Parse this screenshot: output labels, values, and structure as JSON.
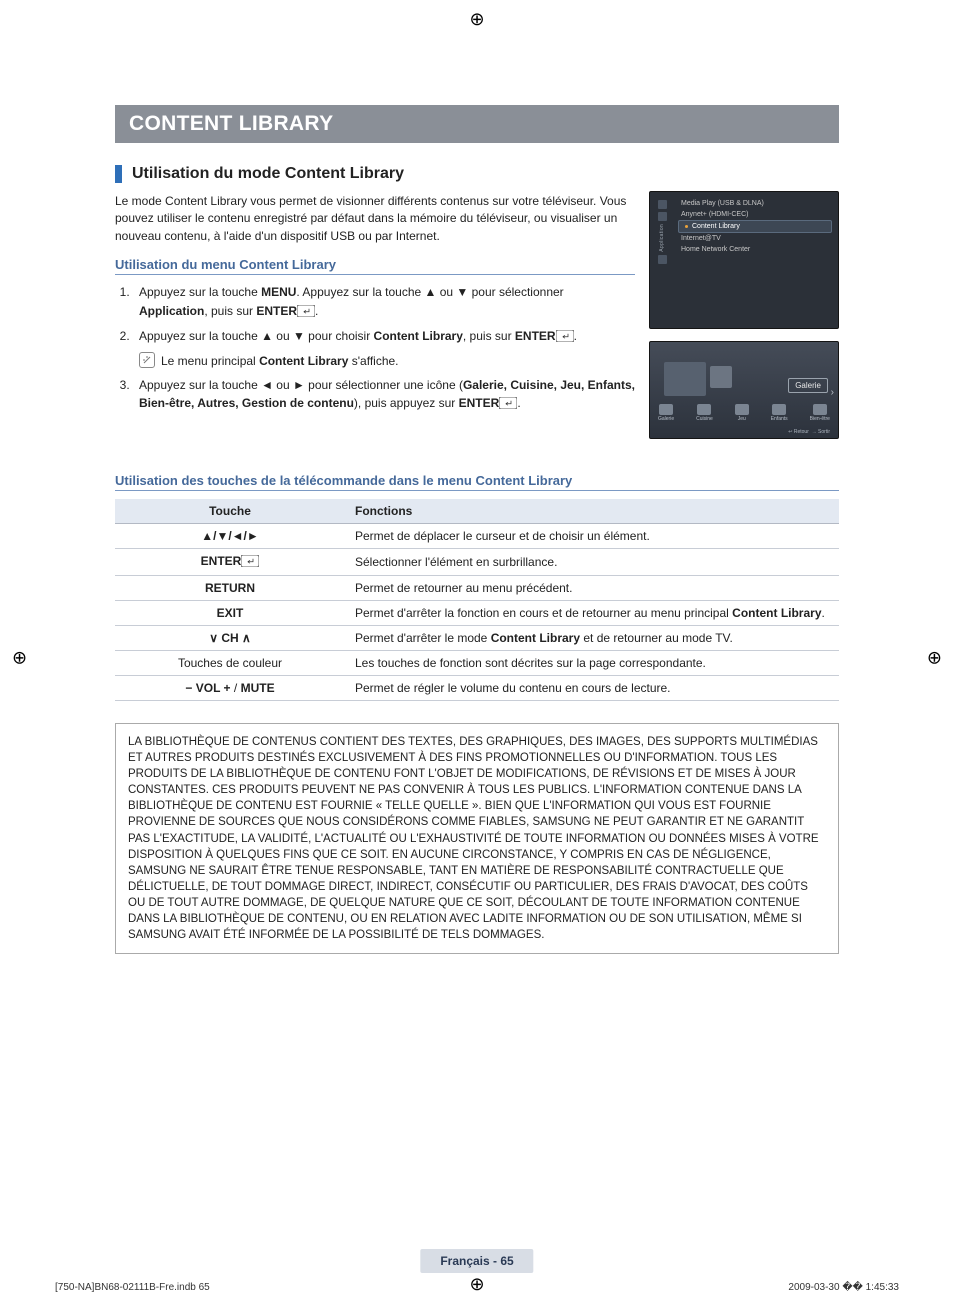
{
  "banner": "CONTENT LIBRARY",
  "h2": "Utilisation du mode Content Library",
  "intro": "Le mode Content Library vous permet de visionner différents contenus sur votre téléviseur. Vous pouvez utiliser le contenu enregistré par défaut dans la mémoire du téléviseur, ou visualiser un nouveau contenu, à l'aide d'un dispositif USB ou par Internet.",
  "sub1": "Utilisation du menu Content Library",
  "steps": {
    "s1a": "Appuyez sur la touche ",
    "s1b": "MENU",
    "s1c": ". Appuyez sur la touche ▲ ou ▼ pour sélectionner ",
    "s1d": "Application",
    "s1e": ", puis sur ",
    "s1f": "ENTER",
    "s1g": ".",
    "s2a": "Appuyez sur la touche ▲ ou ▼ pour choisir ",
    "s2b": "Content Library",
    "s2c": ", puis sur ",
    "s2d": "ENTER",
    "s2e": ".",
    "note_a": "Le menu principal ",
    "note_b": "Content Library",
    "note_c": " s'affiche.",
    "s3a": "Appuyez sur la touche ◄ ou ► pour sélectionner une icône (",
    "s3b": "Galerie, Cuisine, Jeu, Enfants, Bien-être, Autres, Gestion de contenu",
    "s3c": "), puis appuyez sur ",
    "s3d": "ENTER",
    "s3e": "."
  },
  "osd1": {
    "sideLabel": "Application",
    "i1": "Media Play (USB & DLNA)",
    "i2": "Anynet+ (HDMI-CEC)",
    "i3": "Content Library",
    "i4": "Internet@TV",
    "i5": "Home Network Center"
  },
  "osd2": {
    "btn": "Galerie",
    "ic1": "Galerie",
    "ic2": "Cuisine",
    "ic3": "Jeu",
    "ic4": "Enfants",
    "ic5": "Bien-être",
    "foot1": "↩ Retour",
    "foot2": "→ Sortir"
  },
  "sub2": "Utilisation des touches de la télécommande dans le menu Content Library",
  "table": {
    "h1": "Touche",
    "h2": "Fonctions",
    "r1k": "▲/▼/◄/►",
    "r1v": "Permet de déplacer le curseur et de choisir un élément.",
    "r2k": "ENTER",
    "r2v": "Sélectionner l'élément en surbrillance.",
    "r3k": "RETURN",
    "r3v": "Permet de retourner au menu précédent.",
    "r4k": "EXIT",
    "r4v_a": "Permet d'arrêter la fonction en cours et de retourner au menu principal ",
    "r4v_b": "Content Library",
    "r4v_c": ".",
    "r5k": "∨ CH ∧",
    "r5v_a": "Permet d'arrêter le mode ",
    "r5v_b": "Content Library",
    "r5v_c": " et de retourner au mode TV.",
    "r6k": "Touches de couleur",
    "r6v": "Les touches de fonction sont décrites sur la page correspondante.",
    "r7k_a": "− VOL +",
    "r7k_b": " / ",
    "r7k_c": "MUTE",
    "r7v": "Permet de régler le volume du contenu en cours de lecture."
  },
  "legal": "LA BIBLIOTHÈQUE DE CONTENUS CONTIENT DES TEXTES, DES GRAPHIQUES, DES IMAGES, DES SUPPORTS MULTIMÉDIAS ET AUTRES PRODUITS DESTINÉS EXCLUSIVEMENT À DES FINS PROMOTIONNELLES OU D'INFORMATION. TOUS LES PRODUITS DE LA BIBLIOTHÈQUE DE CONTENU FONT L'OBJET DE MODIFICATIONS, DE RÉVISIONS ET DE MISES À JOUR CONSTANTES. CES PRODUITS PEUVENT NE PAS CONVENIR À TOUS LES PUBLICS. L'INFORMATION CONTENUE DANS LA BIBLIOTHÈQUE DE CONTENU EST FOURNIE « TELLE QUELLE ». BIEN QUE L'INFORMATION QUI VOUS EST FOURNIE PROVIENNE DE SOURCES QUE NOUS CONSIDÉRONS COMME FIABLES, SAMSUNG NE PEUT GARANTIR ET NE GARANTIT PAS L'EXACTITUDE, LA VALIDITÉ, L'ACTUALITÉ OU L'EXHAUSTIVITÉ DE TOUTE INFORMATION OU DONNÉES MISES À VOTRE DISPOSITION À QUELQUES FINS QUE CE SOIT. EN AUCUNE CIRCONSTANCE, Y COMPRIS EN CAS DE NÉGLIGENCE, SAMSUNG NE SAURAIT ÊTRE TENUE RESPONSABLE, TANT EN MATIÈRE DE RESPONSABILITÉ CONTRACTUELLE QUE DÉLICTUELLE, DE TOUT DOMMAGE DIRECT, INDIRECT, CONSÉCUTIF OU PARTICULIER, DES FRAIS D'AVOCAT, DES COÛTS OU DE TOUT AUTRE DOMMAGE, DE QUELQUE NATURE QUE CE SOIT, DÉCOULANT DE TOUTE INFORMATION CONTENUE DANS LA BIBLIOTHÈQUE DE CONTENU, OU EN RELATION AVEC LADITE INFORMATION OU DE SON UTILISATION, MÊME SI SAMSUNG AVAIT ÉTÉ INFORMÉE DE LA POSSIBILITÉ DE TELS DOMMAGES.",
  "pagenum": "Français - 65",
  "footer": {
    "left": "[750-NA]BN68-02111B-Fre.indb   65",
    "right": "2009-03-30   �� 1:45:33"
  }
}
